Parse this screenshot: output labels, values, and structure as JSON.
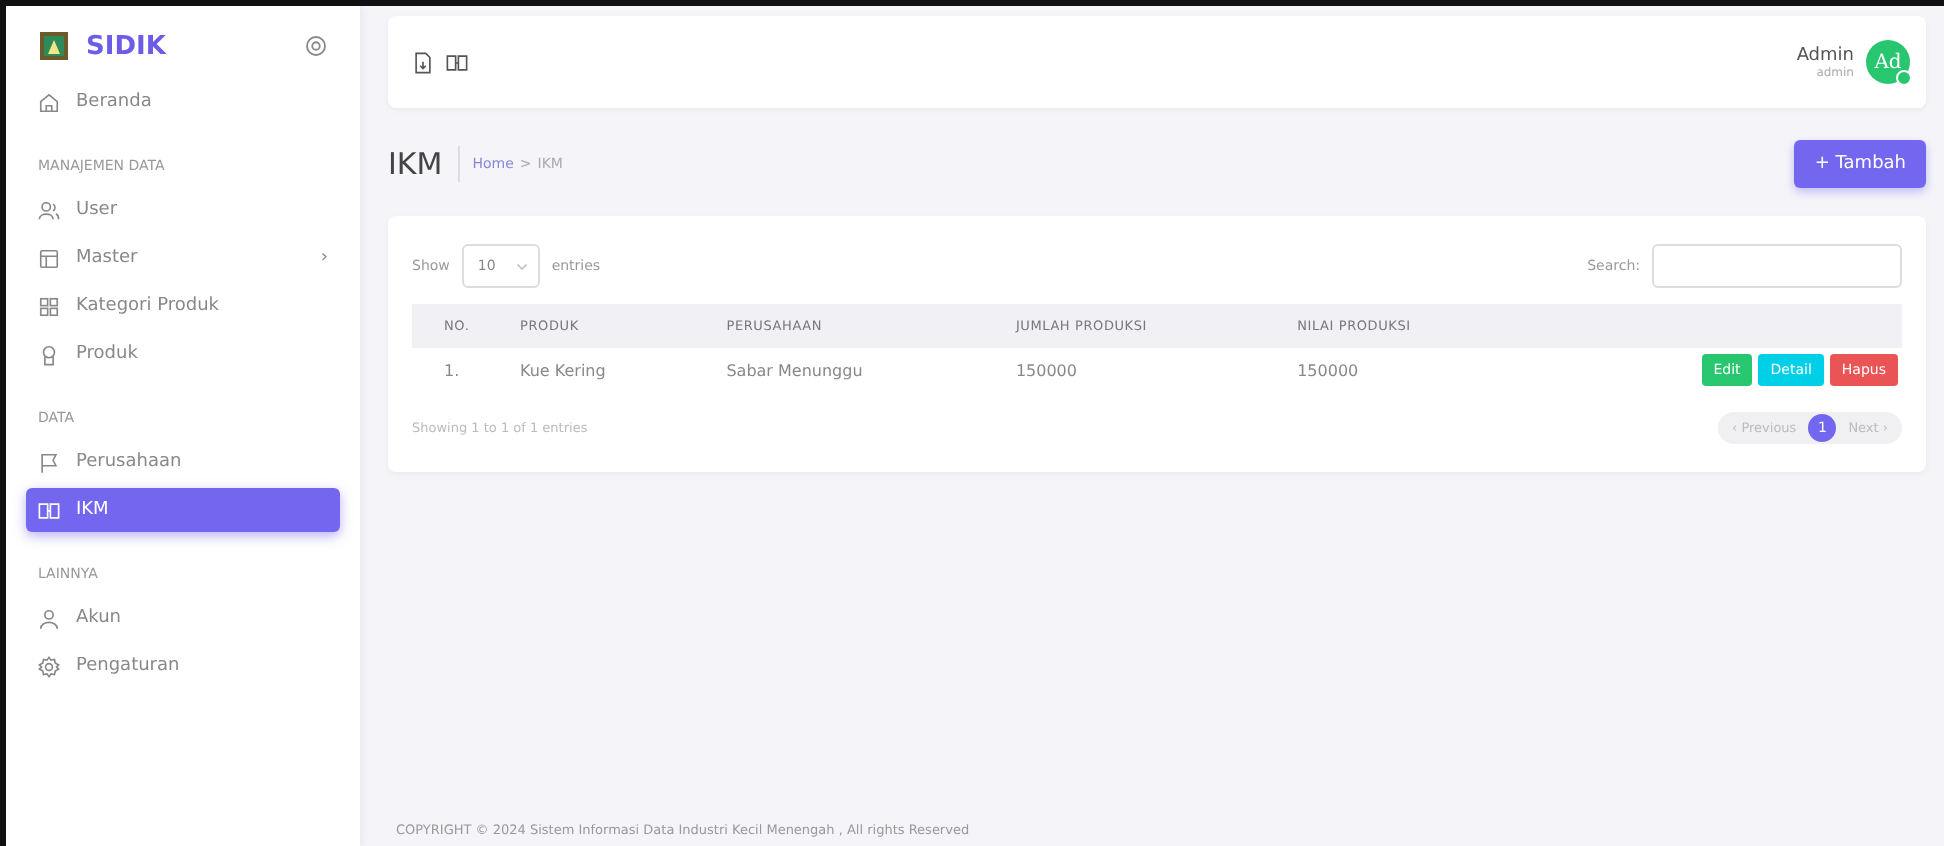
{
  "brand": {
    "name": "SIDIK"
  },
  "sidebar": {
    "sections": [
      {
        "items": [
          {
            "label": "Beranda",
            "kind": "home",
            "selected": false
          }
        ]
      },
      {
        "heading": "MANAJEMEN DATA",
        "items": [
          {
            "label": "User",
            "kind": "users",
            "selected": false
          },
          {
            "label": "Master",
            "kind": "layout",
            "selected": false,
            "chevron": "›"
          },
          {
            "label": "Kategori Produk",
            "kind": "grid",
            "selected": false
          },
          {
            "label": "Produk",
            "kind": "award",
            "selected": false
          }
        ]
      },
      {
        "heading": "DATA",
        "items": [
          {
            "label": "Perusahaan",
            "kind": "flag",
            "selected": false
          },
          {
            "label": "IKM",
            "kind": "book",
            "selected": true
          }
        ]
      },
      {
        "heading": "LAINNYA",
        "items": [
          {
            "label": "Akun",
            "kind": "user",
            "selected": false
          },
          {
            "label": "Pengaturan",
            "kind": "gear",
            "selected": false
          }
        ]
      }
    ]
  },
  "user": {
    "name": "Admin",
    "role": "admin",
    "initials": "Ad",
    "online": true
  },
  "page": {
    "title": "IKM",
    "breadcrumb": [
      {
        "label": "Home"
      },
      {
        "label": "IKM"
      }
    ],
    "breadcrumb_separator": ">",
    "add_button": "+ Tambah"
  },
  "table": {
    "show_label": "Show",
    "page_size": "10",
    "entries_label": "entries",
    "search_label": "Search:",
    "columns": [
      "NO.",
      "PRODUK",
      "PERUSAHAAN",
      "JUMLAH PRODUKSI",
      "NILAI PRODUKSI"
    ],
    "rows": [
      {
        "cells": [
          "1.",
          "Kue Kering",
          "Sabar Menunggu",
          "150000",
          "150000"
        ],
        "actions": [
          {
            "label": "Edit",
            "kind": "edit"
          },
          {
            "label": "Detail",
            "kind": "detail"
          },
          {
            "label": "Hapus",
            "kind": "delete"
          }
        ]
      }
    ],
    "info": "Showing 1 to 1 of 1 entries",
    "pagination": {
      "previous": "‹ Previous",
      "next": "Next ›",
      "pages": [
        {
          "label": "1",
          "selected": true
        }
      ]
    }
  },
  "footer": "COPYRIGHT © 2024  Sistem Informasi Data Industri Kecil Menengah , All rights Reserved"
}
